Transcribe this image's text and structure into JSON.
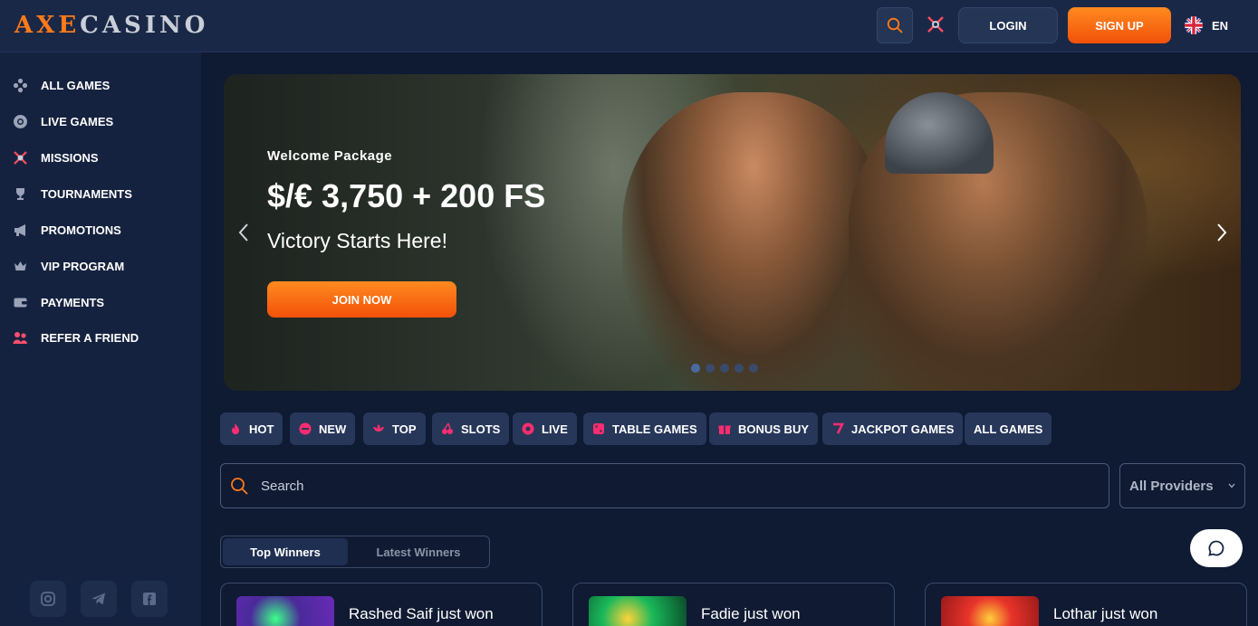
{
  "header": {
    "logo_part1": "AXE",
    "logo_part2": "CASINO",
    "login_label": "LOGIN",
    "signup_label": "SIGN UP",
    "language": "EN",
    "accent_color": "#ff7a1a"
  },
  "sidebar": {
    "items": [
      {
        "label": "ALL GAMES",
        "icon": "gamepad-icon"
      },
      {
        "label": "LIVE GAMES",
        "icon": "poker-chip-icon"
      },
      {
        "label": "MISSIONS",
        "icon": "crossed-swords-icon"
      },
      {
        "label": "TOURNAMENTS",
        "icon": "trophy-icon"
      },
      {
        "label": "PROMOTIONS",
        "icon": "megaphone-icon"
      },
      {
        "label": "VIP PROGRAM",
        "icon": "crown-icon"
      },
      {
        "label": "PAYMENTS",
        "icon": "wallet-icon"
      },
      {
        "label": "REFER A FRIEND",
        "icon": "users-icon"
      }
    ],
    "social": [
      "instagram-icon",
      "telegram-icon",
      "facebook-icon"
    ]
  },
  "banner": {
    "subtitle": "Welcome Package",
    "title": "$/€ 3,750 + 200 FS",
    "tagline": "Victory Starts Here!",
    "cta_label": "JOIN NOW",
    "slide_count": 5,
    "active_slide": 1
  },
  "categories": [
    {
      "label": "HOT",
      "icon": "flame-icon"
    },
    {
      "label": "NEW",
      "icon": "new-badge-icon"
    },
    {
      "label": "TOP",
      "icon": "lotus-icon"
    },
    {
      "label": "SLOTS",
      "icon": "cherries-icon"
    },
    {
      "label": "LIVE",
      "icon": "roulette-icon"
    },
    {
      "label": "TABLE GAMES",
      "icon": "dice-icon"
    },
    {
      "label": "BONUS BUY",
      "icon": "gift-icon"
    },
    {
      "label": "JACKPOT GAMES",
      "icon": "seven-icon"
    },
    {
      "label": "ALL GAMES",
      "icon": ""
    }
  ],
  "search": {
    "placeholder": "Search",
    "providers_label": "All Providers"
  },
  "winner_tabs": {
    "active": "Top Winners",
    "inactive": "Latest Winners"
  },
  "winners": [
    {
      "text": "Rashed Saif just won"
    },
    {
      "text": "Fadie just won"
    },
    {
      "text": "Lothar just won"
    }
  ]
}
